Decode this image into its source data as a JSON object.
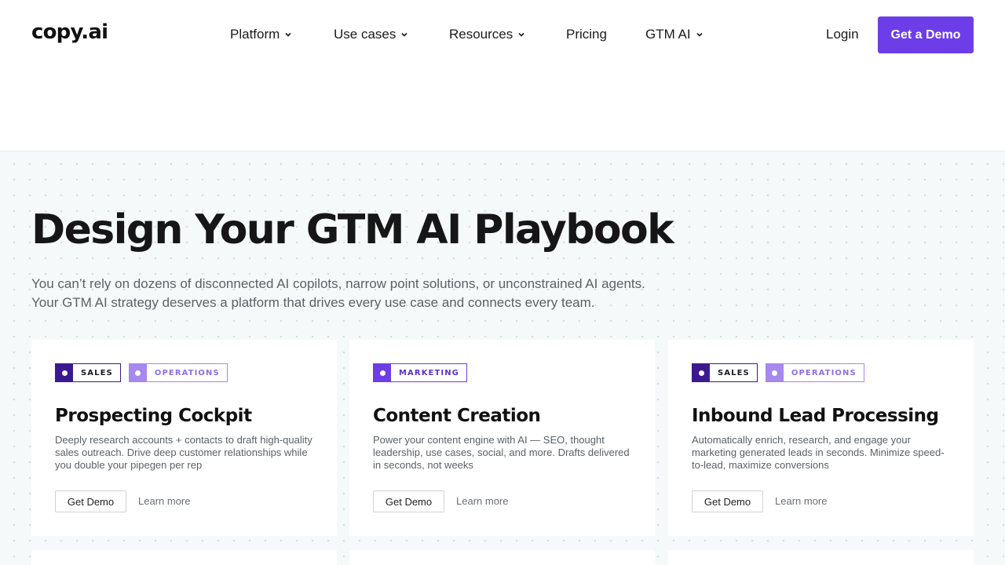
{
  "header": {
    "logo": "copy.ai",
    "nav": [
      {
        "label": "Platform",
        "dropdown": true
      },
      {
        "label": "Use cases",
        "dropdown": true
      },
      {
        "label": "Resources",
        "dropdown": true
      },
      {
        "label": "Pricing",
        "dropdown": false
      },
      {
        "label": "GTM AI",
        "dropdown": true
      }
    ],
    "login": "Login",
    "cta": "Get a Demo"
  },
  "hero": {
    "title": "Design Your GTM AI Playbook",
    "subtitle_line1": "You can’t rely on dozens of disconnected AI copilots, narrow point solutions, or unconstrained AI agents.",
    "subtitle_line2": "Your GTM AI strategy deserves a platform that drives every use case and connects every team."
  },
  "cards": [
    {
      "tags": [
        "SALES",
        "OPERATIONS"
      ],
      "title": "Prospecting Cockpit",
      "description": "Deeply research accounts + contacts to draft high-quality sales outreach. Drive deep customer relationships while you double your pipegen per rep",
      "demo_label": "Get Demo",
      "learn_label": "Learn more"
    },
    {
      "tags": [
        "MARKETING"
      ],
      "title": "Content Creation",
      "description": "Power your content engine with AI — SEO, thought leadership, use cases, social, and more. Drafts delivered in seconds, not weeks",
      "demo_label": "Get Demo",
      "learn_label": "Learn more"
    },
    {
      "tags": [
        "SALES",
        "OPERATIONS"
      ],
      "title": "Inbound Lead Processing",
      "description": "Automatically enrich, research, and engage your marketing generated leads in seconds. Minimize speed-to-lead, maximize conversions",
      "demo_label": "Get Demo",
      "learn_label": "Learn more"
    }
  ],
  "colors": {
    "brand": "#6d3ee8",
    "tag_sales": "#3b1a8f",
    "tag_operations": "#a688ef",
    "hero_background": "#f6f9fa"
  },
  "icons": {
    "nav_dropdown": "chevron-down-icon",
    "tag_marker": "dot-icon"
  }
}
